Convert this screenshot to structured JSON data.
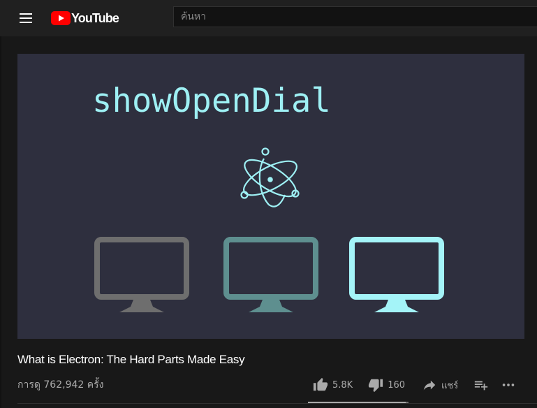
{
  "header": {
    "logo_text": "YouTube",
    "search_placeholder": "ค้นหา"
  },
  "video": {
    "frame_text": "showOpenDial",
    "title": "What is Electron: The Hard Parts Made Easy",
    "views": "การดู 762,942 ครั้ง"
  },
  "actions": {
    "like_count": "5.8K",
    "dislike_count": "160",
    "share_label": "แชร์",
    "like_ratio": 0.97
  },
  "colors": {
    "brand_red": "#ff0000",
    "video_bg": "#2e2f3e",
    "frame_text": "#9ef0f4",
    "monitor_gray": "#6e6e6e",
    "monitor_teal": "#5e8f8f",
    "monitor_cyan": "#a4f4f8"
  },
  "icons": [
    "menu-icon",
    "youtube-logo-icon",
    "electron-atom-icon",
    "monitor-icon",
    "thumb-up-icon",
    "thumb-down-icon",
    "share-arrow-icon",
    "add-to-playlist-icon",
    "more-dots-icon"
  ]
}
